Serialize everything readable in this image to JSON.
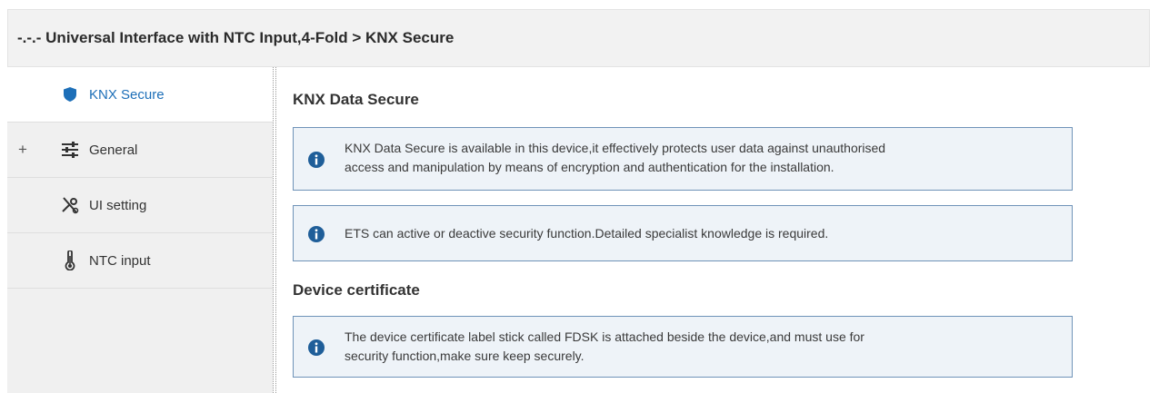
{
  "header": {
    "title": "-.-.- Universal Interface with NTC Input,4-Fold > KNX Secure"
  },
  "sidebar": {
    "items": [
      {
        "label": "KNX Secure",
        "icon": "shield-icon",
        "active": true,
        "expander": ""
      },
      {
        "label": "General",
        "icon": "sliders-icon",
        "active": false,
        "expander": "+"
      },
      {
        "label": "UI setting",
        "icon": "tools-icon",
        "active": false,
        "expander": ""
      },
      {
        "label": "NTC input",
        "icon": "thermometer-icon",
        "active": false,
        "expander": ""
      }
    ]
  },
  "main": {
    "sections": [
      {
        "title": "KNX Data Secure"
      },
      {
        "title": "Device certificate"
      }
    ],
    "info_boxes": [
      {
        "lines": [
          "KNX Data Secure is available in this device,it effectively protects user data against unauthorised",
          "access and manipulation by means of encryption and authentication for the installation."
        ]
      },
      {
        "lines": [
          "ETS can active or deactive security function.Detailed specialist knowledge is required."
        ]
      },
      {
        "lines": [
          "The device certificate label stick called FDSK is attached beside the device,and must use for",
          "security function,make sure keep securely."
        ]
      }
    ]
  },
  "colors": {
    "accent": "#1d6fb8",
    "info_icon": "#1f5e99",
    "info_bg": "#eef3f8",
    "info_border": "#6f93b8",
    "sidebar_bg": "#f0f0f0"
  }
}
